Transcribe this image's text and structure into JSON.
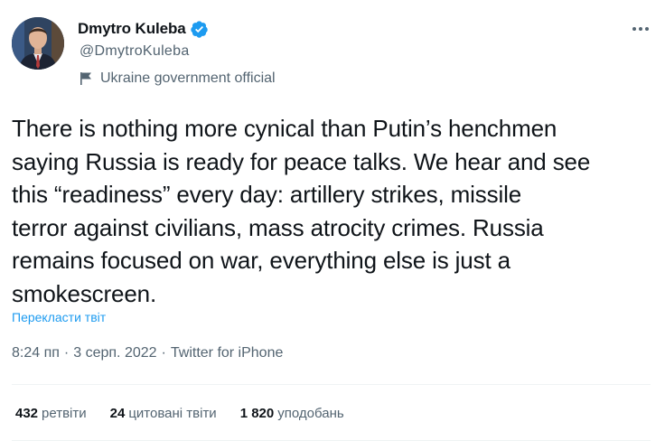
{
  "author": {
    "display_name": "Dmytro Kuleba",
    "handle": "@DmytroKuleba",
    "affiliation": "Ukraine government official",
    "verified_color": "#1d9bf0"
  },
  "tweet": {
    "text": "There is nothing more cynical than Putin’s henchmen\nsaying Russia is ready for peace talks. We hear and see\nthis “readiness” every day: artillery strikes, missile\nterror against civilians, mass atrocity crimes. Russia\nremains focused on war, everything else is just a\nsmokescreen.",
    "translate_label": "Перекласти твіт",
    "time": "8:24 пп",
    "date": "3 серп. 2022",
    "source": "Twitter for iPhone",
    "separator": "·"
  },
  "stats": [
    {
      "count": "432",
      "label": "ретвіти"
    },
    {
      "count": "24",
      "label": "цитовані твіти"
    },
    {
      "count": "1 820",
      "label": "уподобань"
    }
  ],
  "icons": {
    "more": "more-horizontal-icon",
    "verified": "verified-badge-icon",
    "affiliation": "flag-icon"
  }
}
